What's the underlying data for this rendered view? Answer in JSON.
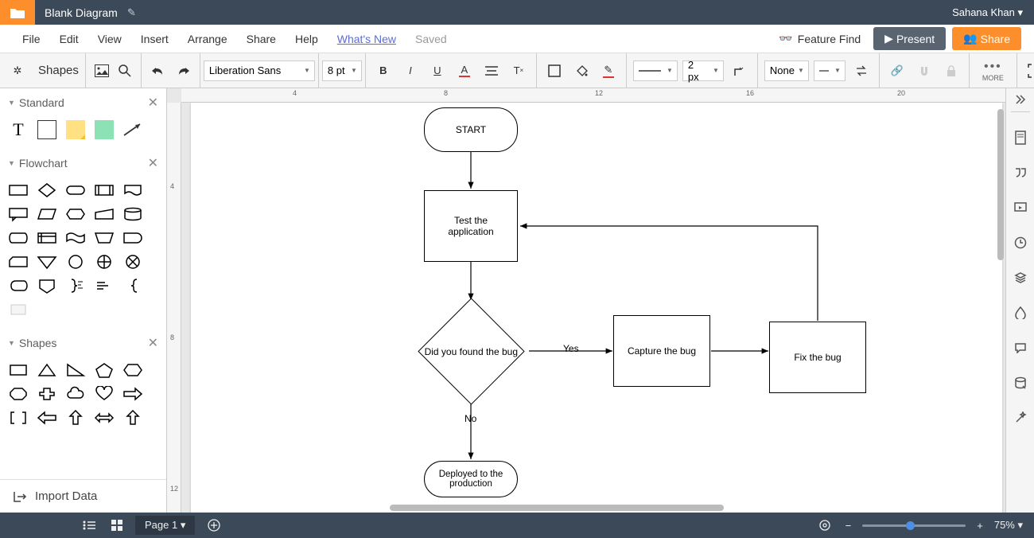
{
  "header": {
    "doc_title": "Blank Diagram",
    "user_name": "Sahana Khan ▾"
  },
  "menu": {
    "file": "File",
    "edit": "Edit",
    "view": "View",
    "insert": "Insert",
    "arrange": "Arrange",
    "share": "Share",
    "help": "Help",
    "whatsnew": "What's New",
    "saved": "Saved",
    "feature_find": "Feature Find",
    "present": "Present",
    "share_btn": "Share"
  },
  "toolbar": {
    "shapes_label": "Shapes",
    "font": "Liberation Sans",
    "font_size": "8 pt",
    "stroke_width": "2 px",
    "line_style": "None",
    "more": "MORE"
  },
  "left_panel": {
    "groups": {
      "standard": "Standard",
      "flowchart": "Flowchart",
      "shapes": "Shapes"
    },
    "import": "Import Data"
  },
  "ruler": {
    "h": [
      "4",
      "8",
      "12",
      "16",
      "20"
    ],
    "v": [
      "4",
      "8",
      "12"
    ]
  },
  "flow": {
    "start": "START",
    "test": "Test the\napplication",
    "decision": "Did you found the bug",
    "yes": "Yes",
    "no": "No",
    "capture": "Capture the bug",
    "fix": "Fix the bug",
    "deploy": "Deployed to the\nproduction"
  },
  "footer": {
    "page": "Page 1 ▾",
    "zoom": "75% ▾"
  },
  "chart_data": {
    "type": "flowchart",
    "title": "",
    "nodes": [
      {
        "id": "start",
        "type": "terminator",
        "label": "START"
      },
      {
        "id": "test",
        "type": "process",
        "label": "Test the application"
      },
      {
        "id": "decide",
        "type": "decision",
        "label": "Did you found the bug"
      },
      {
        "id": "capture",
        "type": "process",
        "label": "Capture the bug"
      },
      {
        "id": "fix",
        "type": "process",
        "label": "Fix the bug"
      },
      {
        "id": "deploy",
        "type": "terminator",
        "label": "Deployed to the production"
      }
    ],
    "edges": [
      {
        "from": "start",
        "to": "test",
        "label": ""
      },
      {
        "from": "test",
        "to": "decide",
        "label": ""
      },
      {
        "from": "decide",
        "to": "capture",
        "label": "Yes"
      },
      {
        "from": "capture",
        "to": "fix",
        "label": ""
      },
      {
        "from": "fix",
        "to": "test",
        "label": ""
      },
      {
        "from": "decide",
        "to": "deploy",
        "label": "No"
      }
    ]
  }
}
